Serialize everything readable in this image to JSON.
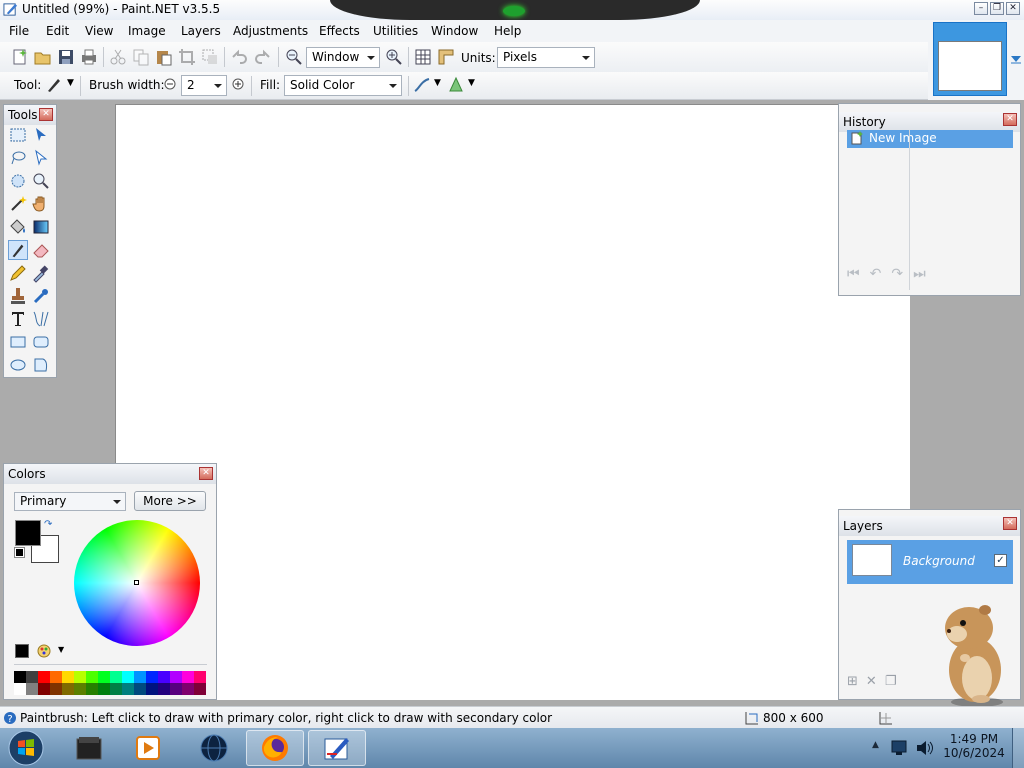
{
  "window": {
    "title": "Untitled (99%) - Paint.NET v3.5.5",
    "minimize_glyph": "–",
    "restore_glyph": "❐",
    "close_glyph": "✕"
  },
  "menu": [
    "File",
    "Edit",
    "View",
    "Image",
    "Layers",
    "Adjustments",
    "Effects",
    "Utilities",
    "Window",
    "Help"
  ],
  "toolbar": {
    "zoom_value": "Window",
    "units_label": "Units:",
    "units_value": "Pixels",
    "tool_label": "Tool:",
    "brush_width_label": "Brush width:",
    "brush_width_value": "2",
    "fill_label": "Fill:",
    "fill_value": "Solid Color"
  },
  "tools_panel": {
    "title": "Tools",
    "active_tool": "paintbrush-icon"
  },
  "history_panel": {
    "title": "History",
    "items": [
      "New Image"
    ]
  },
  "layers_panel": {
    "title": "Layers",
    "layers": [
      {
        "name": "Background",
        "visible": true
      }
    ]
  },
  "colors_panel": {
    "title": "Colors",
    "mode_value": "Primary",
    "more_button": "More >>",
    "primary_color": "#000000",
    "secondary_color": "#ffffff"
  },
  "status": {
    "message": "Paintbrush: Left click to draw with primary color, right click to draw with secondary color",
    "image_size": "800 x 600"
  },
  "taskbar": {
    "time": "1:49 PM",
    "date": "10/6/2024"
  },
  "palette": {
    "row1": [
      "#000000",
      "#404040",
      "#ff0000",
      "#ff6a00",
      "#ffd800",
      "#b6ff00",
      "#4cff00",
      "#00ff21",
      "#00ff90",
      "#00ffff",
      "#0094ff",
      "#0026ff",
      "#4800ff",
      "#b200ff",
      "#ff00dc",
      "#ff006e"
    ],
    "row2": [
      "#ffffff",
      "#808080",
      "#7f0000",
      "#7f3300",
      "#7f6a00",
      "#5b7f00",
      "#267f00",
      "#007f0e",
      "#007f46",
      "#007f7f",
      "#004a7f",
      "#00137f",
      "#21007f",
      "#57007f",
      "#7f006e",
      "#7f0037"
    ]
  }
}
